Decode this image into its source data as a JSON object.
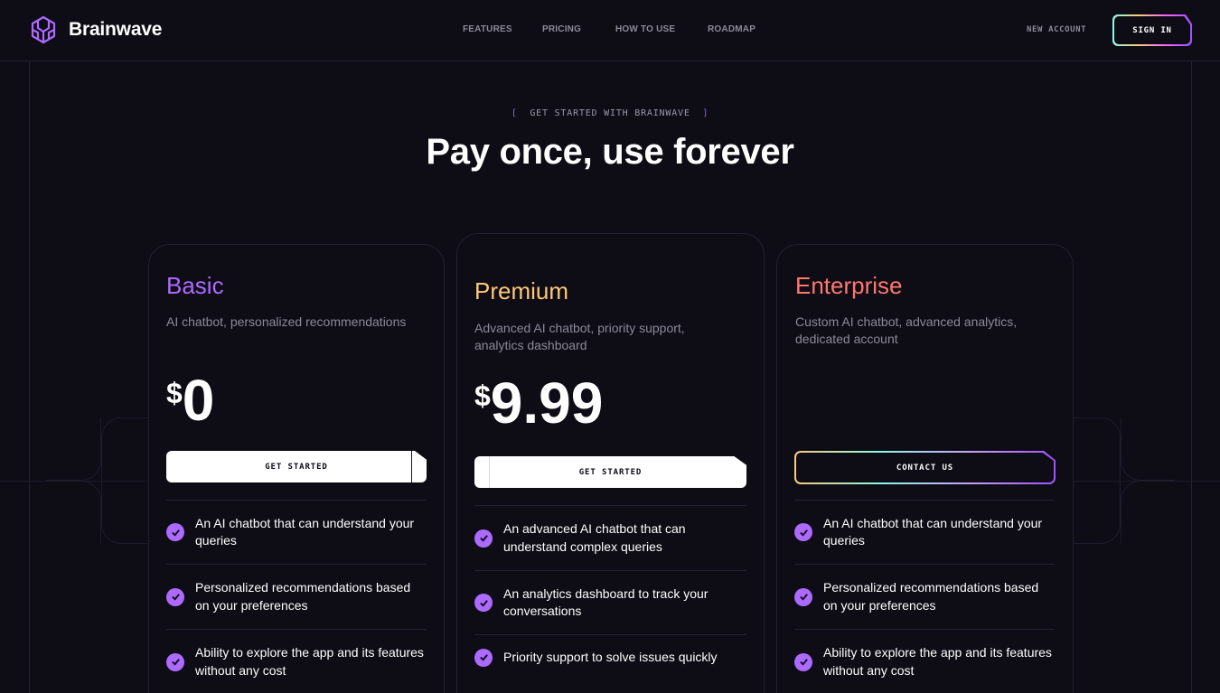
{
  "brand": {
    "name": "Brainwave",
    "logo_icon": "brainwave-logo-icon",
    "accent": "#ac6aff"
  },
  "nav": {
    "links": [
      "Features",
      "Pricing",
      "How to use",
      "Roadmap"
    ],
    "new_account": "NEW ACCOUNT",
    "sign_in": "SIGN IN"
  },
  "section": {
    "eyebrow_open": "[",
    "eyebrow": "GET STARTED WITH BRAINWAVE",
    "eyebrow_close": "]",
    "headline": "Pay once, use forever"
  },
  "plans": [
    {
      "title": "Basic",
      "color": "#ac6aff",
      "description": "AI chatbot, personalized recommendations",
      "currency": "$",
      "price": "0",
      "button": "GET STARTED",
      "features": [
        "An AI chatbot that can understand your queries",
        "Personalized recommendations based on your preferences",
        "Ability to explore the app and its features without any cost"
      ]
    },
    {
      "title": "Premium",
      "color": "#ffc876",
      "description": "Advanced AI chatbot, priority support, analytics dashboard",
      "currency": "$",
      "price": "9.99",
      "button": "GET STARTED",
      "features": [
        "An advanced AI chatbot that can understand complex queries",
        "An analytics dashboard to track your conversations",
        "Priority support to solve issues quickly"
      ]
    },
    {
      "title": "Enterprise",
      "color": "#ff776f",
      "description": "Custom AI chatbot, advanced analytics, dedicated account",
      "button": "CONTACT US",
      "features": [
        "An AI chatbot that can understand your queries",
        "Personalized recommendations based on your preferences",
        "Ability to explore the app and its features without any cost"
      ]
    }
  ]
}
